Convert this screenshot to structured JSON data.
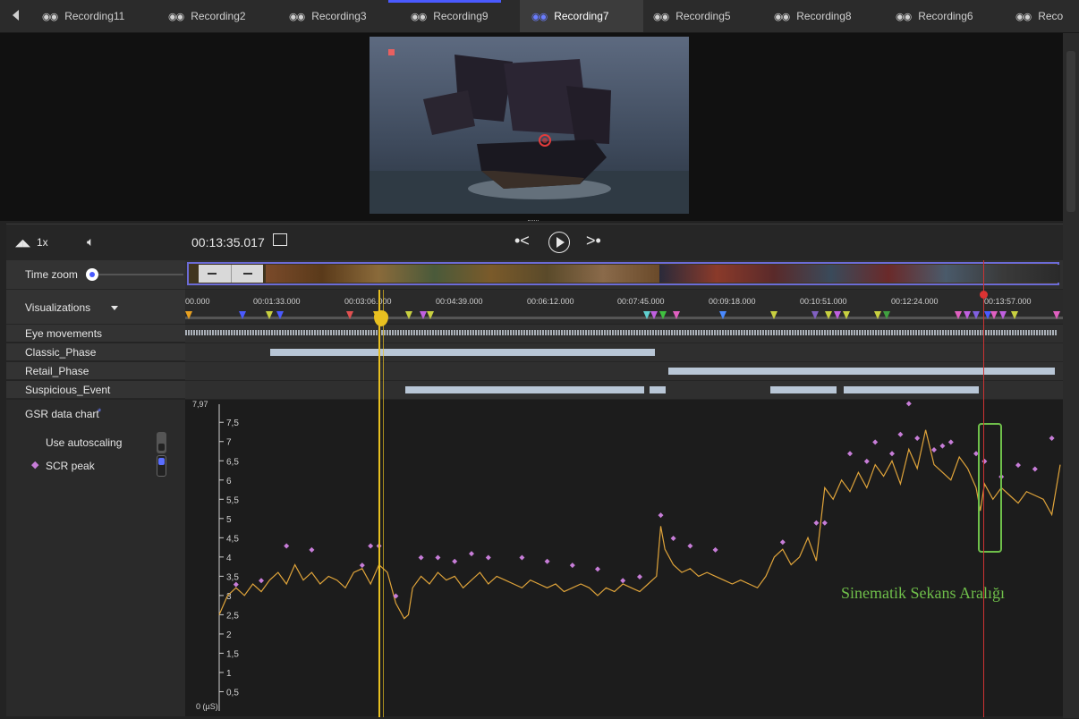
{
  "tabs": [
    {
      "label": "Recording11",
      "active": false
    },
    {
      "label": "Recording2",
      "active": false
    },
    {
      "label": "Recording3",
      "active": false
    },
    {
      "label": "Recording9",
      "active": false
    },
    {
      "label": "Recording7",
      "active": true
    },
    {
      "label": "Recording5",
      "active": false
    },
    {
      "label": "Recording8",
      "active": false
    },
    {
      "label": "Recording6",
      "active": false
    },
    {
      "label": "Reco",
      "active": false
    }
  ],
  "controls": {
    "speed": "1x",
    "timestamp": "00:13:35.017"
  },
  "rows": {
    "time_zoom": "Time zoom",
    "visualizations": "Visualizations",
    "eye_movements": "Eye movements",
    "classic_phase": "Classic_Phase",
    "retail_phase": "Retail_Phase",
    "suspicious_event": "Suspicious_Event"
  },
  "timeline_ticks": [
    "00.000",
    "00:01:33.000",
    "00:03:06.000",
    "00:04:39.000",
    "00:06:12.000",
    "00:07:45.000",
    "00:09:18.000",
    "00:10:51.000",
    "00:12:24.000",
    "00:13:57.000"
  ],
  "gsr": {
    "title": "GSR data chart",
    "required_mark": "*",
    "autoscaling_label": "Use autoscaling",
    "scr_peak_label": "SCR peak"
  },
  "annotation": "Sinematik Sekans Aralığı",
  "colors": {
    "accent": "#4a5aff",
    "gsr_line": "#e0a43a",
    "peak": "#c77dd8",
    "playhead": "#e8c020",
    "annotation": "#6fbf4a"
  },
  "chart_data": {
    "type": "line",
    "title": "",
    "xlabel": "",
    "ylabel": "",
    "y_unit_label": "0 (µS)",
    "ylim": [
      0,
      7.97
    ],
    "y_max_label": "7,97",
    "y_ticks": [
      "7,5",
      "7",
      "6,5",
      "6",
      "5,5",
      "5",
      "4,5",
      "4",
      "3,5",
      "3",
      "2,5",
      "2",
      "1,5",
      "1",
      "0,5"
    ],
    "series": [
      {
        "x": [
          0,
          0.01,
          0.02,
          0.03,
          0.04,
          0.05,
          0.06,
          0.07,
          0.08,
          0.09,
          0.1,
          0.11,
          0.12,
          0.13,
          0.14,
          0.15,
          0.16,
          0.17,
          0.18,
          0.19,
          0.2,
          0.21,
          0.22,
          0.225,
          0.23,
          0.24,
          0.25,
          0.26,
          0.27,
          0.28,
          0.29,
          0.3,
          0.31,
          0.32,
          0.33,
          0.34,
          0.35,
          0.36,
          0.37,
          0.38,
          0.39,
          0.4,
          0.41,
          0.42,
          0.43,
          0.44,
          0.45,
          0.46,
          0.47,
          0.48,
          0.49,
          0.5,
          0.51,
          0.52,
          0.525,
          0.53,
          0.54,
          0.55,
          0.56,
          0.57,
          0.58,
          0.59,
          0.6,
          0.61,
          0.62,
          0.63,
          0.64,
          0.65,
          0.66,
          0.67,
          0.68,
          0.69,
          0.7,
          0.71,
          0.72,
          0.73,
          0.74,
          0.75,
          0.76,
          0.77,
          0.78,
          0.79,
          0.8,
          0.81,
          0.82,
          0.83,
          0.84,
          0.85,
          0.86,
          0.87,
          0.88,
          0.89,
          0.9,
          0.905,
          0.91,
          0.92,
          0.93,
          0.94,
          0.95,
          0.96,
          0.97,
          0.98,
          0.99,
          1.0
        ],
        "y": [
          2.5,
          3.0,
          3.2,
          3.0,
          3.3,
          3.1,
          3.4,
          3.6,
          3.3,
          3.8,
          3.4,
          3.6,
          3.3,
          3.5,
          3.4,
          3.2,
          3.6,
          3.7,
          3.3,
          3.8,
          3.6,
          2.8,
          2.4,
          2.5,
          3.2,
          3.5,
          3.3,
          3.6,
          3.4,
          3.5,
          3.2,
          3.4,
          3.6,
          3.3,
          3.5,
          3.4,
          3.3,
          3.2,
          3.4,
          3.3,
          3.2,
          3.3,
          3.1,
          3.2,
          3.3,
          3.2,
          3.0,
          3.2,
          3.1,
          3.3,
          3.2,
          3.1,
          3.3,
          3.5,
          4.8,
          4.2,
          3.8,
          3.6,
          3.7,
          3.5,
          3.6,
          3.5,
          3.4,
          3.3,
          3.4,
          3.3,
          3.2,
          3.5,
          4.0,
          4.2,
          3.8,
          4.0,
          4.5,
          3.9,
          5.8,
          5.5,
          6.0,
          5.7,
          6.2,
          5.8,
          6.4,
          6.1,
          6.5,
          5.9,
          6.8,
          6.3,
          7.3,
          6.4,
          6.2,
          6.0,
          6.6,
          6.3,
          5.8,
          5.2,
          5.9,
          5.5,
          5.8,
          5.6,
          5.4,
          5.7,
          5.6,
          5.5,
          5.1,
          6.4
        ]
      }
    ],
    "scr_peaks": {
      "x": [
        0.02,
        0.05,
        0.08,
        0.11,
        0.17,
        0.18,
        0.19,
        0.21,
        0.24,
        0.26,
        0.28,
        0.3,
        0.32,
        0.36,
        0.39,
        0.42,
        0.45,
        0.48,
        0.5,
        0.525,
        0.54,
        0.56,
        0.59,
        0.67,
        0.71,
        0.72,
        0.75,
        0.77,
        0.78,
        0.8,
        0.81,
        0.82,
        0.83,
        0.85,
        0.86,
        0.87,
        0.9,
        0.91,
        0.93,
        0.95,
        0.97,
        0.99
      ],
      "y": [
        3.1,
        3.2,
        4.1,
        4.0,
        3.6,
        4.1,
        4.1,
        2.8,
        3.8,
        3.8,
        3.7,
        3.9,
        3.8,
        3.8,
        3.7,
        3.6,
        3.5,
        3.2,
        3.3,
        4.9,
        4.3,
        4.1,
        4.0,
        4.2,
        4.7,
        4.7,
        6.5,
        6.3,
        6.8,
        6.5,
        7.0,
        7.8,
        6.9,
        6.6,
        6.7,
        6.8,
        6.5,
        6.3,
        5.9,
        6.2,
        6.1,
        6.9
      ]
    }
  }
}
